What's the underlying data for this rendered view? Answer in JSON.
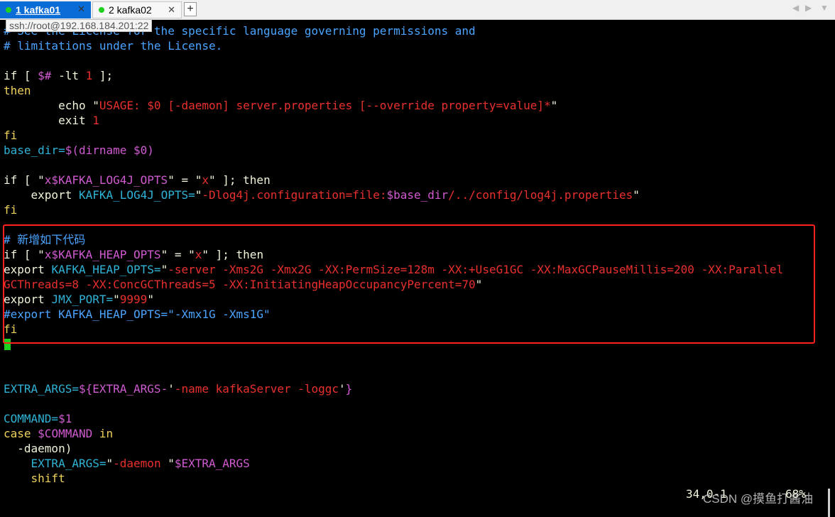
{
  "tabs": [
    {
      "label": "1 kafka01",
      "active": true
    },
    {
      "label": "2 kafka02",
      "active": false
    }
  ],
  "tab_close_glyph": "✕",
  "new_tab_glyph": "+",
  "nav_prev_glyph": "◀",
  "nav_next_glyph": "▶",
  "nav_menu_glyph": "▼",
  "tooltip": "ssh://root@192.168.184.201:22",
  "editor_lines": [
    [
      "# See the License for the specific language governing permissions and"
    ],
    [
      "# limitations under the License."
    ],
    [
      ""
    ],
    [
      "if [ ",
      "$#",
      " -lt ",
      "1",
      " ];"
    ],
    [
      "then"
    ],
    [
      "        echo \"",
      "USAGE: $0 [-daemon] server.properties [--override property=value]*",
      "\""
    ],
    [
      "        exit ",
      "1"
    ],
    [
      "fi"
    ],
    [
      "base_dir=",
      "$(dirname $0)"
    ],
    [
      ""
    ],
    [
      "if [ \"",
      "x$KAFKA_LOG4J_OPTS",
      "\" = \"",
      "x",
      "\" ]; then"
    ],
    [
      "    export ",
      "KAFKA_LOG4J_OPTS=",
      "\"",
      "-Dlog4j.configuration=file:",
      "$base_dir",
      "/../config/log4j.properties",
      "\""
    ],
    [
      "fi"
    ],
    [
      ""
    ],
    [
      "# 新增如下代码"
    ],
    [
      "if [ \"",
      "x$KAFKA_HEAP_OPTS",
      "\" = \"",
      "x",
      "\" ]; then"
    ],
    [
      "export ",
      "KAFKA_HEAP_OPTS=",
      "\"",
      "-server -Xms2G -Xmx2G -XX:PermSize=128m -XX:+UseG1GC -XX:MaxGCPauseMillis=200 -XX:Parallel"
    ],
    [
      "GCThreads=8 -XX:ConcGCThreads=5 -XX:InitiatingHeapOccupancyPercent=70",
      "\""
    ],
    [
      "export ",
      "JMX_PORT=",
      "\"",
      "9999",
      "\""
    ],
    [
      "#export KAFKA_HEAP_OPTS=\"-Xmx1G -Xms1G\""
    ],
    [
      "fi"
    ],
    [
      ""
    ],
    [
      ""
    ],
    [
      ""
    ],
    [
      "EXTRA_ARGS=",
      "${EXTRA_ARGS-",
      "'",
      "-name kafkaServer -loggc",
      "'",
      "}"
    ],
    [
      ""
    ],
    [
      "COMMAND=",
      "$1"
    ],
    [
      "case ",
      "$COMMAND",
      " in"
    ],
    [
      "  -daemon)"
    ],
    [
      "    EXTRA_ARGS=",
      "\"",
      "-daemon ",
      "\"",
      "$EXTRA_ARGS"
    ],
    [
      "    shift"
    ]
  ],
  "status_position": "34,0-1",
  "status_percent": "68%",
  "watermark": "CSDN @摸鱼打酱油",
  "colors": {
    "tab_active": "#0a6cd6",
    "highlight_box": "#ff2020",
    "cursor": "#1fd11f",
    "comment": "#4aa4ff",
    "string": "#e8302e",
    "variable": "#d05ad0",
    "identifier": "#2fb3d6"
  }
}
